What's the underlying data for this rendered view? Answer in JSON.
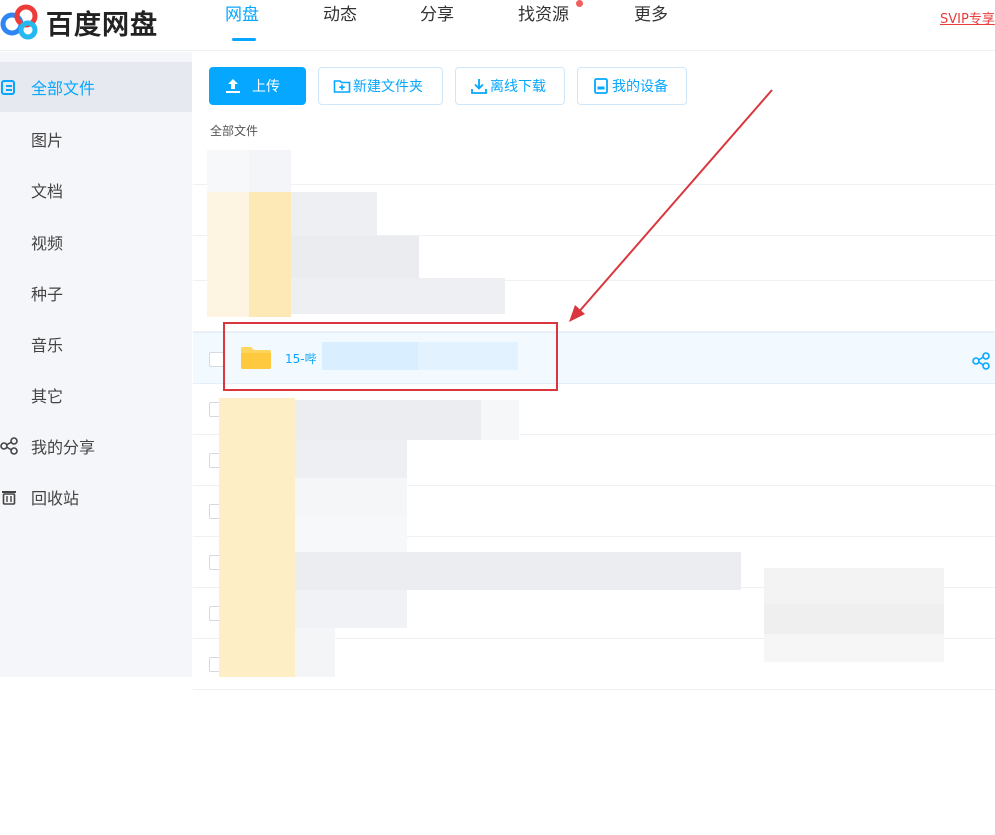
{
  "header": {
    "logo_text": "百度网盘",
    "nav": [
      "网盘",
      "动态",
      "分享",
      "找资源",
      "更多"
    ],
    "svip": "SVIP专享"
  },
  "sidebar": {
    "items": [
      "全部文件",
      "图片",
      "文档",
      "视频",
      "种子",
      "音乐",
      "其它",
      "我的分享",
      "回收站"
    ]
  },
  "toolbar": {
    "upload": "上传",
    "new_folder": "新建文件夹",
    "offline_download": "离线下载",
    "my_devices": "我的设备"
  },
  "breadcrumb": "全部文件",
  "files": {
    "highlighted_name": "15-哔"
  },
  "colors": {
    "accent": "#06a7ff",
    "annotation": "#d9363e",
    "folder": "#fdd55d"
  }
}
